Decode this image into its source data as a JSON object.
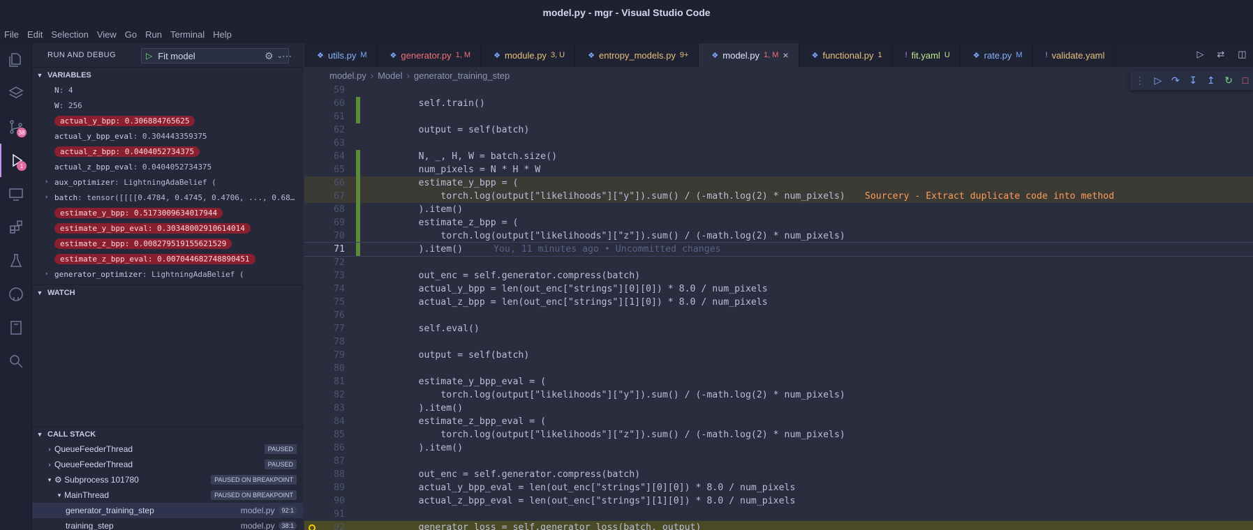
{
  "title": "model.py - mgr - Visual Studio Code",
  "menu": [
    "File",
    "Edit",
    "Selection",
    "View",
    "Go",
    "Run",
    "Terminal",
    "Help"
  ],
  "activity_badges": {
    "source_control": "38",
    "debug": "1"
  },
  "sidebar": {
    "header": "RUN AND DEBUG",
    "config": "Fit model",
    "variables_title": "VARIABLES",
    "variables": [
      {
        "name": "N",
        "value": "4",
        "changed": false,
        "expandable": false
      },
      {
        "name": "W",
        "value": "256",
        "changed": false,
        "expandable": false
      },
      {
        "name": "actual_y_bpp",
        "value": "0.306884765625",
        "changed": true,
        "expandable": false
      },
      {
        "name": "actual_y_bpp_eval",
        "value": "0.304443359375",
        "changed": false,
        "expandable": false
      },
      {
        "name": "actual_z_bpp",
        "value": "0.0404052734375",
        "changed": true,
        "expandable": false
      },
      {
        "name": "actual_z_bpp_eval",
        "value": "0.0404052734375",
        "changed": false,
        "expandable": false
      },
      {
        "name": "aux_optimizer",
        "value": "LightningAdaBelief (",
        "changed": false,
        "expandable": true
      },
      {
        "name": "batch",
        "value": "tensor([[[[0.4784, 0.4745, 0.4706,  ..., 0.68…",
        "changed": false,
        "expandable": true
      },
      {
        "name": "estimate_y_bpp",
        "value": "0.5173009634017944",
        "changed": true,
        "expandable": false
      },
      {
        "name": "estimate_y_bpp_eval",
        "value": "0.30348002910614014",
        "changed": true,
        "expandable": false
      },
      {
        "name": "estimate_z_bpp",
        "value": "0.008279519155621529",
        "changed": true,
        "expandable": false
      },
      {
        "name": "estimate_z_bpp_eval",
        "value": "0.007044682748890451",
        "changed": true,
        "expandable": false
      },
      {
        "name": "generator_optimizer",
        "value": "LightningAdaBelief (",
        "changed": false,
        "expandable": true
      }
    ],
    "watch_title": "WATCH",
    "callstack_title": "CALL STACK",
    "callstack": [
      {
        "label": "QueueFeederThread",
        "tag": "PAUSED",
        "indent": 1,
        "twisty": ">"
      },
      {
        "label": "QueueFeederThread",
        "tag": "PAUSED",
        "indent": 1,
        "twisty": ">"
      },
      {
        "label": "⚙ Subprocess 101780",
        "tag": "PAUSED ON BREAKPOINT",
        "indent": 1,
        "twisty": "v"
      },
      {
        "label": "MainThread",
        "tag": "PAUSED ON BREAKPOINT",
        "indent": 2,
        "twisty": "v"
      }
    ],
    "frames": [
      {
        "name": "generator_training_step",
        "file": "model.py",
        "pos": "92:1",
        "selected": true
      },
      {
        "name": "training_step",
        "file": "model.py",
        "pos": "38:1",
        "selected": false
      }
    ]
  },
  "tabs": [
    {
      "icon": "❖",
      "label": "utils.py",
      "status": "M",
      "color": "#89b4fa",
      "statusColor": "#82aaff",
      "active": false
    },
    {
      "icon": "❖",
      "label": "generator.py",
      "status": "1, M",
      "color": "#f07178",
      "statusColor": "#f07178",
      "active": false
    },
    {
      "icon": "❖",
      "label": "module.py",
      "status": "3, U",
      "color": "#e6c07b",
      "statusColor": "#e6c07b",
      "active": false
    },
    {
      "icon": "❖",
      "label": "entropy_models.py",
      "status": "9+",
      "color": "#e6c07b",
      "statusColor": "#e6c07b",
      "active": false
    },
    {
      "icon": "❖",
      "label": "model.py",
      "status": "1, M",
      "color": "#e2e6ff",
      "statusColor": "#f07178",
      "active": true
    },
    {
      "icon": "❖",
      "label": "functional.py",
      "status": "1",
      "color": "#e6c07b",
      "statusColor": "#e6c07b",
      "active": false
    },
    {
      "icon": "!",
      "label": "fit.yaml",
      "status": "U",
      "color": "#c3e88d",
      "statusColor": "#c3e88d",
      "active": false
    },
    {
      "icon": "❖",
      "label": "rate.py",
      "status": "M",
      "color": "#89b4fa",
      "statusColor": "#82aaff",
      "active": false
    },
    {
      "icon": "!",
      "label": "validate.yaml",
      "status": "",
      "color": "#e6c07b",
      "statusColor": "#e6c07b",
      "active": false
    }
  ],
  "breadcrumb": [
    "model.py",
    "Model",
    "generator_training_step"
  ],
  "code": [
    {
      "n": "59",
      "t": ""
    },
    {
      "n": "60",
      "t": "        self.train()",
      "g": true
    },
    {
      "n": "61",
      "t": "",
      "g": true
    },
    {
      "n": "62",
      "t": "        output = self(batch)"
    },
    {
      "n": "63",
      "t": ""
    },
    {
      "n": "64",
      "t": "        N, _, H, W = batch.size()",
      "g": true
    },
    {
      "n": "65",
      "t": "        num_pixels = N * H * W",
      "g": true
    },
    {
      "n": "66",
      "t": "        estimate_y_bpp = (",
      "g": true,
      "hl": true
    },
    {
      "n": "67",
      "t": "            torch.log(output[\"likelihoods\"][\"y\"]).sum() / (-math.log(2) * num_pixels)",
      "g": true,
      "hl": true,
      "hint": "Sourcery - Extract duplicate code into method"
    },
    {
      "n": "68",
      "t": "        ).item()",
      "g": true
    },
    {
      "n": "69",
      "t": "        estimate_z_bpp = (",
      "g": true
    },
    {
      "n": "70",
      "t": "            torch.log(output[\"likelihoods\"][\"z\"]).sum() / (-math.log(2) * num_pixels)",
      "g": true
    },
    {
      "n": "71",
      "t": "        ).item()",
      "g": true,
      "cur": true,
      "blame": "You, 11 minutes ago • Uncommitted changes"
    },
    {
      "n": "72",
      "t": ""
    },
    {
      "n": "73",
      "t": "        out_enc = self.generator.compress(batch)"
    },
    {
      "n": "74",
      "t": "        actual_y_bpp = len(out_enc[\"strings\"][0][0]) * 8.0 / num_pixels"
    },
    {
      "n": "75",
      "t": "        actual_z_bpp = len(out_enc[\"strings\"][1][0]) * 8.0 / num_pixels"
    },
    {
      "n": "76",
      "t": ""
    },
    {
      "n": "77",
      "t": "        self.eval()"
    },
    {
      "n": "78",
      "t": ""
    },
    {
      "n": "79",
      "t": "        output = self(batch)"
    },
    {
      "n": "80",
      "t": ""
    },
    {
      "n": "81",
      "t": "        estimate_y_bpp_eval = ("
    },
    {
      "n": "82",
      "t": "            torch.log(output[\"likelihoods\"][\"y\"]).sum() / (-math.log(2) * num_pixels)"
    },
    {
      "n": "83",
      "t": "        ).item()"
    },
    {
      "n": "84",
      "t": "        estimate_z_bpp_eval = ("
    },
    {
      "n": "85",
      "t": "            torch.log(output[\"likelihoods\"][\"z\"]).sum() / (-math.log(2) * num_pixels)"
    },
    {
      "n": "86",
      "t": "        ).item()"
    },
    {
      "n": "87",
      "t": ""
    },
    {
      "n": "88",
      "t": "        out_enc = self.generator.compress(batch)"
    },
    {
      "n": "89",
      "t": "        actual_y_bpp_eval = len(out_enc[\"strings\"][0][0]) * 8.0 / num_pixels"
    },
    {
      "n": "90",
      "t": "        actual_z_bpp_eval = len(out_enc[\"strings\"][1][0]) * 8.0 / num_pixels"
    },
    {
      "n": "91",
      "t": ""
    },
    {
      "n": "92",
      "t": "        generator_loss = self.generator_loss(batch, output)",
      "stop": true
    }
  ]
}
